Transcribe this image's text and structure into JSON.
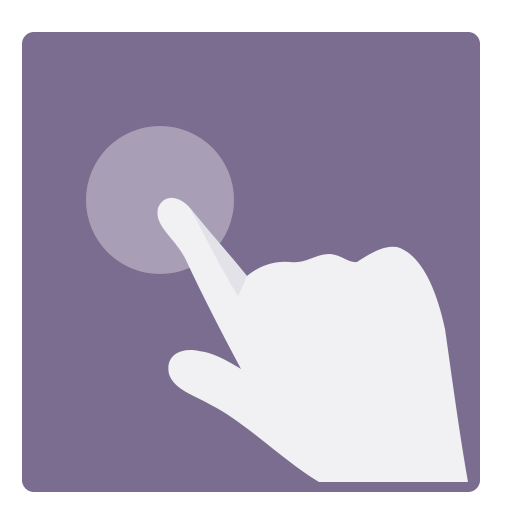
{
  "icon": {
    "name": "tap-gesture-icon",
    "colors": {
      "tile": "#7b6d8f",
      "touch_circle": "#a89fb6",
      "hand": "#f1f1f3",
      "hand_shadow": "#e3e2e8",
      "background": "#ffffff"
    }
  }
}
